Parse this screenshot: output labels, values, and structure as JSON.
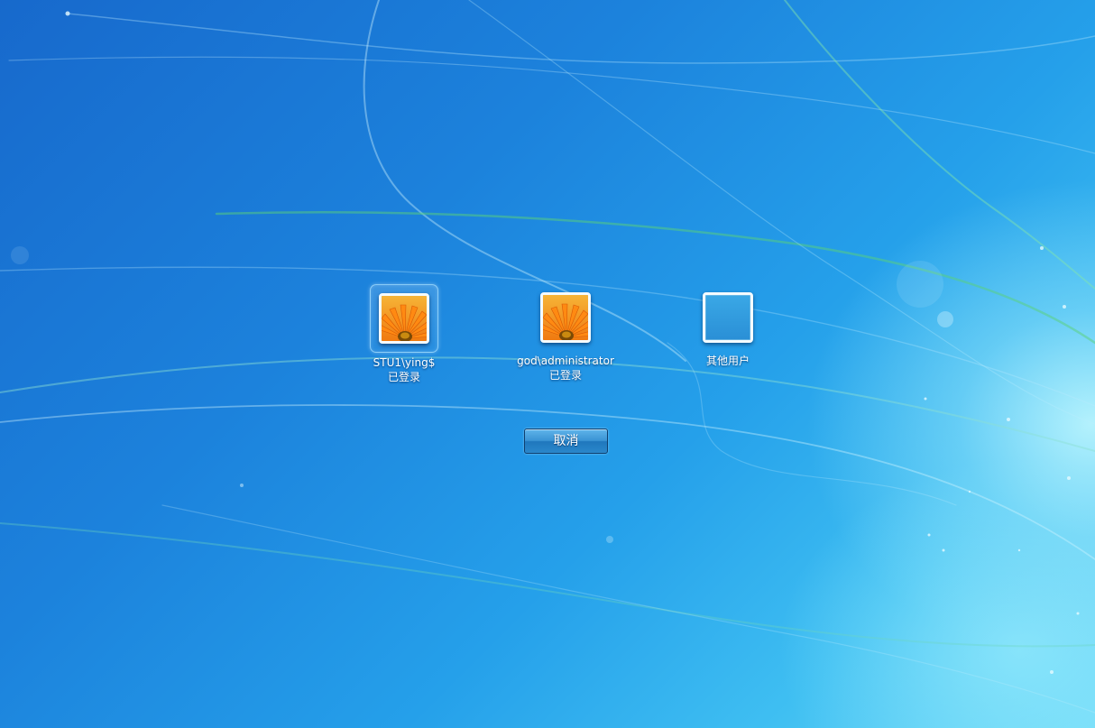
{
  "login_screen": {
    "users": [
      {
        "name": "STU1\\ying$",
        "status": "已登录",
        "avatar_icon": "orange-flower-avatar-icon",
        "selected": true
      },
      {
        "name": "god\\administrator",
        "status": "已登录",
        "avatar_icon": "orange-flower-avatar-icon",
        "selected": false
      },
      {
        "name": "其他用户",
        "status": "",
        "avatar_icon": "blank-avatar-icon",
        "selected": false
      }
    ],
    "cancel_label": "取消"
  },
  "colors": {
    "background_dark": "#1769cc",
    "background_light": "#6fdaf8",
    "button_blue": "#2a87cb",
    "flower_orange": "#f07a10"
  }
}
